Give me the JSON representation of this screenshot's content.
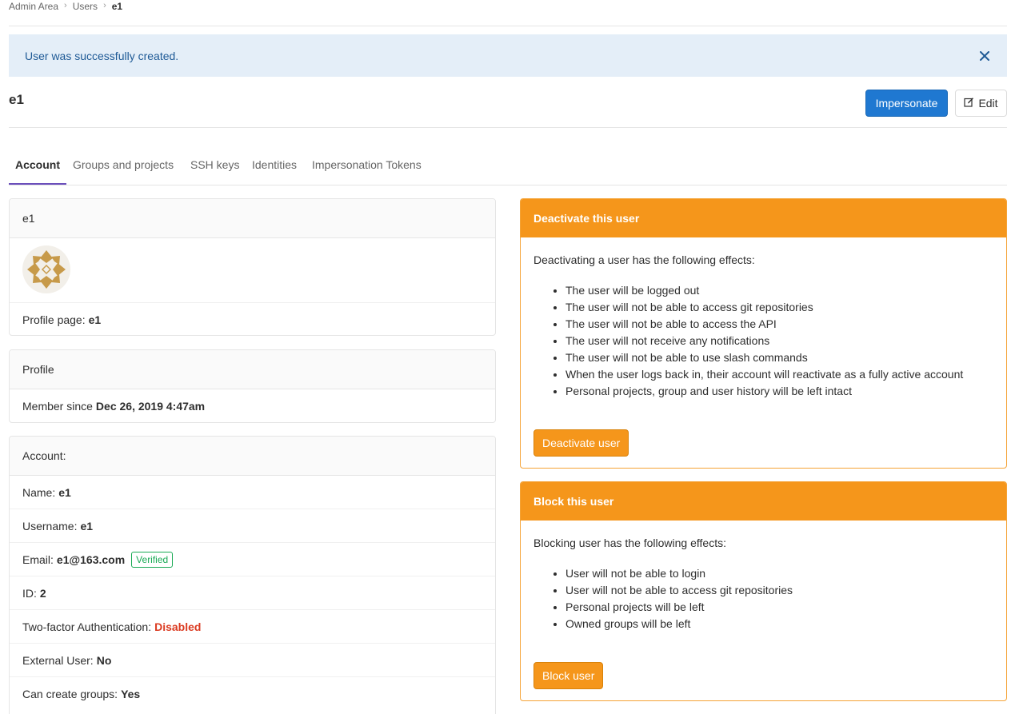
{
  "breadcrumb": {
    "root": "Admin Area",
    "users": "Users",
    "current": "e1"
  },
  "flash": {
    "message": "User was successfully created."
  },
  "header": {
    "title": "e1",
    "impersonate_label": "Impersonate",
    "edit_label": "Edit"
  },
  "tabs": [
    {
      "label": "Account",
      "active": true
    },
    {
      "label": "Groups and projects"
    },
    {
      "label": "SSH keys"
    },
    {
      "label": "Identities"
    },
    {
      "label": "Impersonation Tokens"
    }
  ],
  "user_card": {
    "header": "e1",
    "profile_page_label": "Profile page:",
    "profile_page_value": "e1"
  },
  "profile_card": {
    "header": "Profile",
    "member_since_label": "Member since",
    "member_since_value": "Dec 26, 2019 4:47am"
  },
  "account_card": {
    "header": "Account:",
    "name_label": "Name:",
    "name_value": "e1",
    "username_label": "Username:",
    "username_value": "e1",
    "email_label": "Email:",
    "email_value": "e1@163.com",
    "email_badge": "Verified",
    "id_label": "ID:",
    "id_value": "2",
    "twofa_label": "Two-factor Authentication:",
    "twofa_value": "Disabled",
    "external_label": "External User:",
    "external_value": "No",
    "can_create_label": "Can create groups:",
    "can_create_value": "Yes"
  },
  "deactivate": {
    "header": "Deactivate this user",
    "intro": "Deactivating a user has the following effects:",
    "effects": [
      "The user will be logged out",
      "The user will not be able to access git repositories",
      "The user will not be able to access the API",
      "The user will not receive any notifications",
      "The user will not be able to use slash commands",
      "When the user logs back in, their account will reactivate as a fully active account",
      "Personal projects, group and user history will be left intact"
    ],
    "button": "Deactivate user"
  },
  "block": {
    "header": "Block this user",
    "intro": "Blocking user has the following effects:",
    "effects": [
      "User will not be able to login",
      "User will not be able to access git repositories",
      "Personal projects will be left",
      "Owned groups will be left"
    ],
    "button": "Block user"
  },
  "colors": {
    "primary": "#1f78d1",
    "warning": "#f5961b",
    "flash_bg": "#e4eef8",
    "success": "#1aaa55",
    "danger": "#db3b21",
    "tab_active": "#6b4fbb"
  },
  "icons": {
    "flash_close": "close-icon",
    "edit": "pencil-square-icon",
    "breadcrumb_separator": "chevron-right-icon"
  }
}
